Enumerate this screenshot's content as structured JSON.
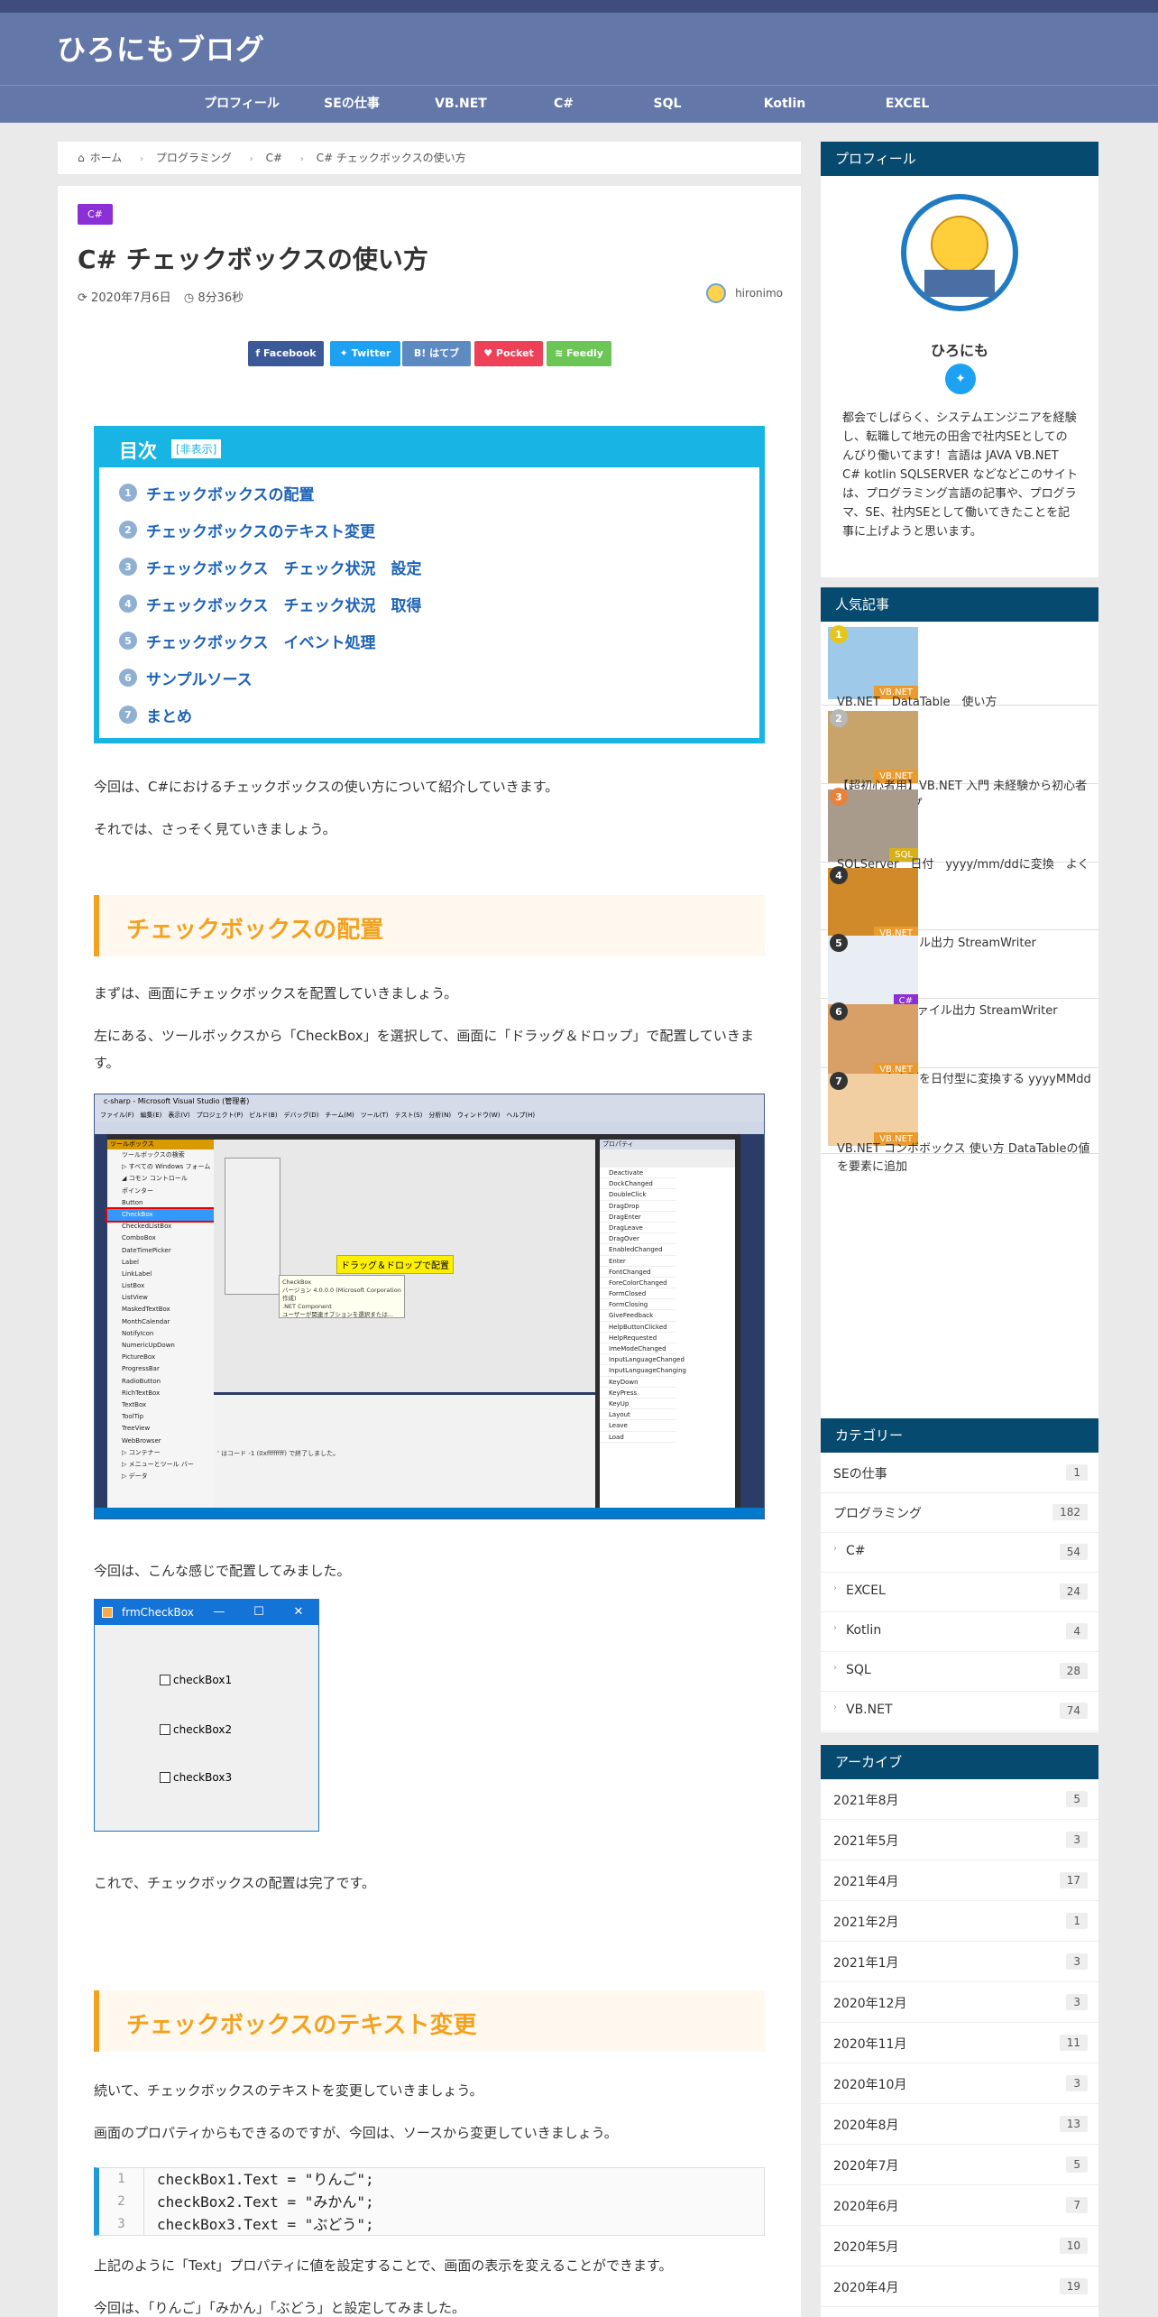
{
  "site": {
    "title": "ひろにもブログ"
  },
  "nav": [
    "プロフィール",
    "SEの仕事",
    "VB.NET",
    "C#",
    "SQL",
    "Kotlin",
    "EXCEL"
  ],
  "breadcrumb": {
    "home": "ホーム",
    "items": [
      "プログラミング",
      "C#",
      "C# チェックボックスの使い方"
    ]
  },
  "post": {
    "category": "C#",
    "title": "C# チェックボックスの使い方",
    "date": "2020年7月6日",
    "read_time": "8分36秒",
    "author": "hironimo"
  },
  "share": [
    {
      "label": "Facebook",
      "icon": "facebook-icon",
      "color": "#3b5998"
    },
    {
      "label": "Twitter",
      "icon": "twitter-icon",
      "color": "#1da1f2"
    },
    {
      "label": "はてブ",
      "icon": "hatena-icon",
      "color": "#5d8ac1"
    },
    {
      "label": "Pocket",
      "icon": "pocket-icon",
      "color": "#ee4056"
    },
    {
      "label": "Feedly",
      "icon": "feedly-icon",
      "color": "#6cc655"
    }
  ],
  "toc": {
    "title": "目次",
    "toggle": "[非表示]",
    "items": [
      "チェックボックスの配置",
      "チェックボックスのテキスト変更",
      "チェックボックス　チェック状況　設定",
      "チェックボックス　チェック状況　取得",
      "チェックボックス　イベント処理",
      "サンプルソース",
      "まとめ"
    ]
  },
  "body": {
    "p1": "今回は、C#におけるチェックボックスの使い方について紹介していきます。",
    "p2": "それでは、さっそく見ていきましょう。",
    "h2_1": "チェックボックスの配置",
    "p3": "まずは、画面にチェックボックスを配置していきましょう。",
    "p4": "左にある、ツールボックスから「CheckBox」を選択して、画面に「ドラッグ＆ドロップ」で配置していきます。",
    "p5": "今回は、こんな感じで配置してみました。",
    "p6": "これで、チェックボックスの配置は完了です。",
    "h2_2": "チェックボックスのテキスト変更",
    "p7": "続いて、チェックボックスのテキストを変更していきましょう。",
    "p8": "画面のプロパティからもできるのですが、今回は、ソースから変更していきましょう。",
    "p9": "上記のように「Text」プロパティに値を設定することで、画面の表示を変えることができます。",
    "p10": "今回は、「りんご」「みかん」「ぶどう」と設定してみました。"
  },
  "vs_screenshot": {
    "title": "c-sharp - Microsoft Visual Studio (管理者)",
    "menu": "ファイル(F)　編集(E)　表示(V)　プロジェクト(P)　ビルド(B)　デバッグ(D)　チーム(M)　ツール(T)　テスト(S)　分析(N)　ウィンドウ(W)　ヘルプ(H)",
    "toolbox_header": "ツールボックス",
    "toolbox_items": [
      "ツールボックスの検索",
      "▷ すべての Windows フォーム",
      "◢ コモン コントロール",
      "ポインター",
      "Button",
      "CheckBox",
      "CheckedListBox",
      "ComboBox",
      "DateTimePicker",
      "Label",
      "LinkLabel",
      "ListBox",
      "ListView",
      "MaskedTextBox",
      "MonthCalendar",
      "NotifyIcon",
      "NumericUpDown",
      "PictureBox",
      "ProgressBar",
      "RadioButton",
      "RichTextBox",
      "TextBox",
      "ToolTip",
      "TreeView",
      "WebBrowser",
      "▷ コンテナー",
      "▷ メニューとツール バー",
      "▷ データ"
    ],
    "callout": "ドラッグ＆ドロップで配置",
    "tooltip": "CheckBox\nバージョン 4.0.0.0 (Microsoft Corporation 作成)\n.NET Component\nユーザーが関連オプションを選択または...",
    "props_header": "プロパティ",
    "props_items": [
      "Deactivate",
      "DockChanged",
      "DoubleClick",
      "DragDrop",
      "DragEnter",
      "DragLeave",
      "DragOver",
      "EnabledChanged",
      "Enter",
      "FontChanged",
      "ForeColorChanged",
      "FormClosed",
      "FormClosing",
      "GiveFeedback",
      "HelpButtonClicked",
      "HelpRequested",
      "ImeModeChanged",
      "InputLanguageChanged",
      "InputLanguageChanging",
      "KeyDown",
      "KeyPress",
      "KeyUp",
      "Layout",
      "Leave",
      "Load"
    ],
    "output_text": "' はコード -1 (0xffffffff) で終了しました。"
  },
  "winform": {
    "title": "frmCheckBox",
    "checkboxes": [
      "checkBox1",
      "checkBox2",
      "checkBox3"
    ]
  },
  "code": {
    "lines": [
      {
        "no": "1",
        "text": "checkBox1.Text = \"りんご\";"
      },
      {
        "no": "2",
        "text": "checkBox2.Text = \"みかん\";"
      },
      {
        "no": "3",
        "text": "checkBox3.Text = \"ぶどう\";"
      }
    ]
  },
  "sidebar": {
    "profile": {
      "title": "プロフィール",
      "name": "ひろにも",
      "bio": "都会でしばらく、システムエンジニアを経験し、転職して地元の田舎で社内SEとしてのんびり働いてます！言語は JAVA VB.NET C# kotlin SQLSERVER などなどこのサイトは、プログラミング言語の記事や、プログラマ、SE、社内SEとして働いてきたことを記事に上げようと思います。"
    },
    "popular": {
      "title": "人気記事",
      "items": [
        {
          "rank": "1",
          "tag": "VB.NET",
          "title": "VB.NET　DataTable　使い方",
          "rank_color": "#e6c61c",
          "tag_color": "#eb9b2d"
        },
        {
          "rank": "2",
          "tag": "VB.NET",
          "title": "【超初心者用】VB.NET 入門 未経験から初心者への10ステップ",
          "rank_color": "#b8b8b8",
          "tag_color": "#eb9b2d"
        },
        {
          "rank": "3",
          "tag": "SQL",
          "title": "SQLServer　日付　yyyy/mm/ddに変換　よく使う日付変換",
          "rank_color": "#e8823a",
          "tag_color": "#d6b11c"
        },
        {
          "rank": "4",
          "tag": "VB.NET",
          "title": "VB.NET ファイル出力 StreamWriter",
          "rank_color": "#333333",
          "tag_color": "#eb9b2d"
        },
        {
          "rank": "5",
          "tag": "C#",
          "title": "C# テキストファイル出力 StreamWriter",
          "rank_color": "#333333",
          "tag_color": "#8b2fd6"
        },
        {
          "rank": "6",
          "tag": "VB.NET",
          "title": "VB.NET 文字列を日付型に変換する yyyyMMdd",
          "rank_color": "#333333",
          "tag_color": "#eb9b2d"
        },
        {
          "rank": "7",
          "tag": "VB.NET",
          "title": "VB.NET コンボボックス 使い方 DataTableの値を要素に追加",
          "rank_color": "#333333",
          "tag_color": "#eb9b2d"
        }
      ]
    },
    "categories": {
      "title": "カテゴリー",
      "items": [
        {
          "label": "SEの仕事",
          "count": "1",
          "child": false
        },
        {
          "label": "プログラミング",
          "count": "182",
          "child": false
        },
        {
          "label": "C#",
          "count": "54",
          "child": true
        },
        {
          "label": "EXCEL",
          "count": "24",
          "child": true
        },
        {
          "label": "Kotlin",
          "count": "4",
          "child": true
        },
        {
          "label": "SQL",
          "count": "28",
          "child": true
        },
        {
          "label": "VB.NET",
          "count": "74",
          "child": true
        }
      ]
    },
    "archive": {
      "title": "アーカイブ",
      "items": [
        {
          "label": "2021年8月",
          "count": "5"
        },
        {
          "label": "2021年5月",
          "count": "3"
        },
        {
          "label": "2021年4月",
          "count": "17"
        },
        {
          "label": "2021年2月",
          "count": "1"
        },
        {
          "label": "2021年1月",
          "count": "3"
        },
        {
          "label": "2020年12月",
          "count": "3"
        },
        {
          "label": "2020年11月",
          "count": "11"
        },
        {
          "label": "2020年10月",
          "count": "3"
        },
        {
          "label": "2020年8月",
          "count": "13"
        },
        {
          "label": "2020年7月",
          "count": "5"
        },
        {
          "label": "2020年6月",
          "count": "7"
        },
        {
          "label": "2020年5月",
          "count": "10"
        },
        {
          "label": "2020年4月",
          "count": "19"
        }
      ]
    }
  }
}
